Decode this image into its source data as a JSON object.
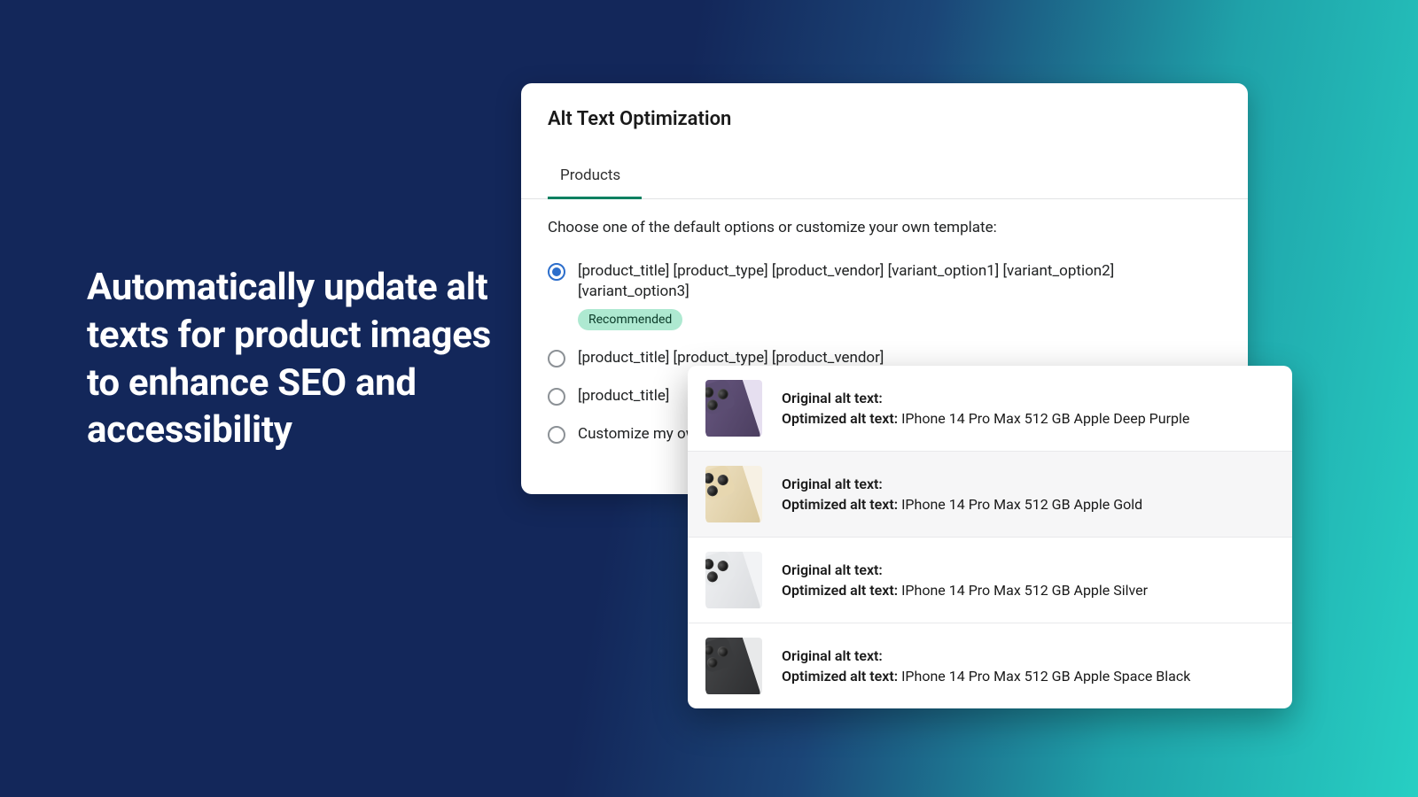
{
  "headline": "Automatically update alt texts for product images to enhance SEO and accessibility",
  "card": {
    "title": "Alt Text Optimization",
    "tab": "Products",
    "instruction": "Choose one of the default options or customize your own template:",
    "recommended_badge": "Recommended",
    "options": [
      "[product_title] [product_type] [product_vendor] [variant_option1] [variant_option2] [variant_option3]",
      "[product_title] [product_type] [product_vendor]",
      "[product_title]",
      "Customize my own template"
    ]
  },
  "preview": {
    "original_label": "Original alt text:",
    "optimized_label": "Optimized alt text:",
    "rows": [
      {
        "color": "purple",
        "optimized": "IPhone 14 Pro Max 512 GB Apple Deep Purple"
      },
      {
        "color": "gold",
        "optimized": "IPhone 14 Pro Max 512 GB Apple Gold"
      },
      {
        "color": "silver",
        "optimized": "IPhone 14 Pro Max 512 GB Apple Silver"
      },
      {
        "color": "black",
        "optimized": "IPhone 14 Pro Max 512 GB Apple Space Black"
      }
    ]
  }
}
